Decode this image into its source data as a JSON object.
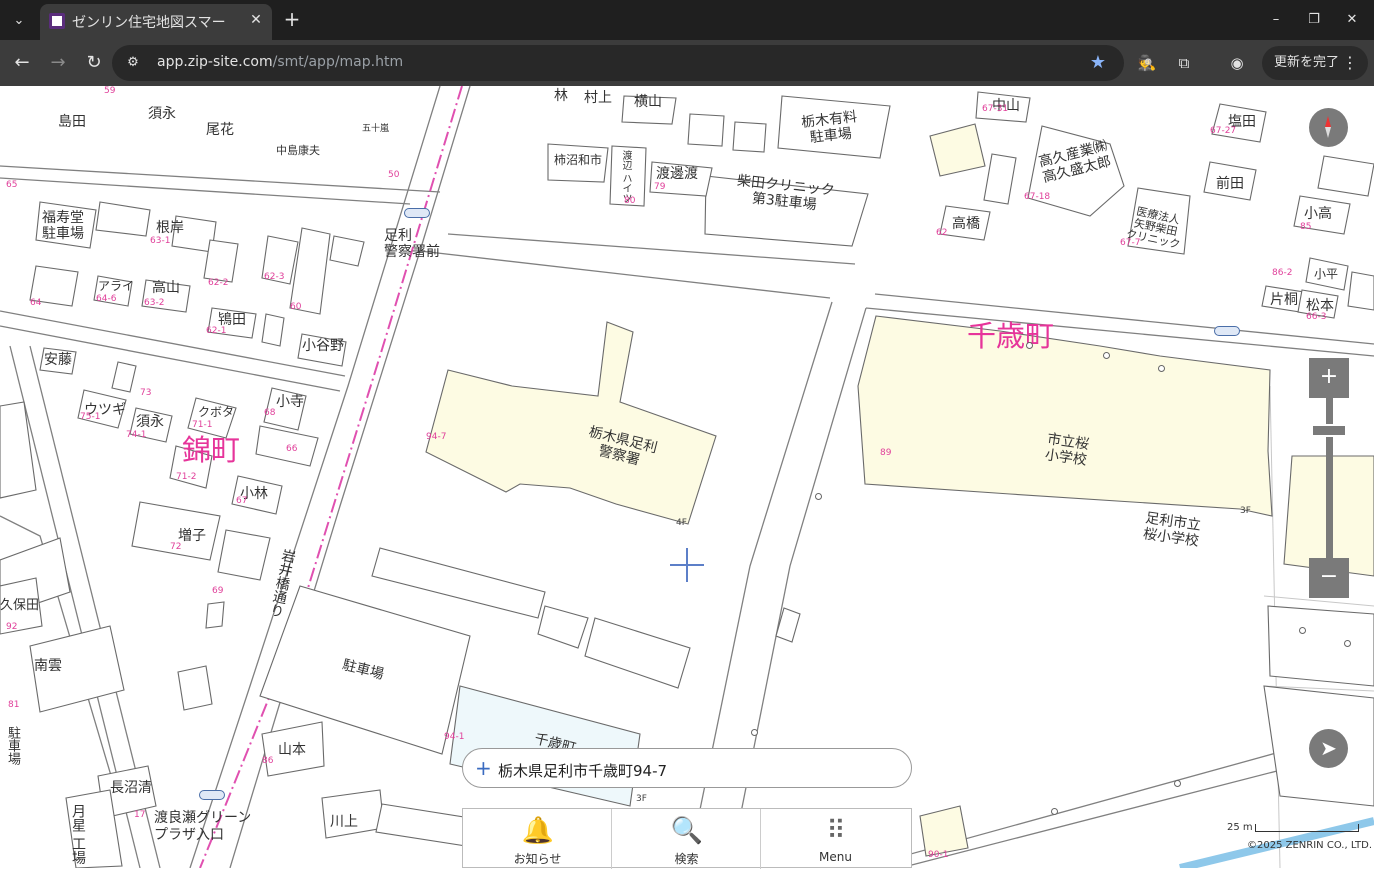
{
  "browser": {
    "tab_title": "ゼンリン住宅地図スマー",
    "url_domain": "app.zip-site.com",
    "url_path": "/smt/app/map.htm",
    "update_label": "更新を完了",
    "accent_color": "#8ab4f8"
  },
  "map": {
    "towns": [
      "千歳町",
      "錦町"
    ],
    "buildings": {
      "police": "栃木県足利\n警察署",
      "school": "市立桜\n小学校",
      "school_name": "足利市立\n桜小学校",
      "parking": "駐車場",
      "paid_parking": "栃木有料\n駐車場",
      "clinic_parking": "柴田クリニック\n第3駐車場",
      "company": "高久産業㈱\n高久盛太郎",
      "hospital": "医療法人\n矢野柴田\nクリニック",
      "fukuju_parking": "福寿堂\n駐車場"
    },
    "stops": {
      "police_stop": "足利\n警察署前",
      "green_plaza": "渡良瀬グリーン\nプラザ入口"
    },
    "street": "岩井橋通り",
    "names": {
      "n1": "島田",
      "n2": "須永",
      "n3": "尾花",
      "n4": "根岸",
      "n5": "高山",
      "n6": "アライ",
      "n7": "鴇田",
      "n8": "小谷野",
      "n9": "安藤",
      "n10": "ウツギ",
      "n11": "須永",
      "n12": "クボタ",
      "n13": "小寺",
      "n14": "小林",
      "n15": "増子",
      "n16": "南雲",
      "n17": "長沼清",
      "n18": "山本",
      "n19": "川上",
      "n20": "柿沼和市",
      "n21": "渡邊渡",
      "n22": "中山",
      "n23": "塩田",
      "n24": "前田",
      "n25": "高橋",
      "n26": "小高",
      "n27": "片桐",
      "n28": "松本",
      "n29": "横山",
      "n30": "林",
      "n31": "中島康夫",
      "n32": "月星\n工場",
      "n33": "久保田",
      "n34": "駐車場",
      "n35": "小平",
      "n36": "渡辺\nハイツ",
      "n37": "千歳町",
      "n38": "五十嵐",
      "n39": "村上"
    },
    "lot_numbers": {
      "p1": "94-7",
      "p2": "89",
      "p3": "4F",
      "p4": "3F",
      "p5": "63-1",
      "p6": "63-2",
      "p7": "64-6",
      "p8": "62-1",
      "p9": "62-2",
      "p10": "62-3",
      "p11": "60",
      "p12": "64",
      "p13": "73",
      "p14": "75-1",
      "p15": "74-1",
      "p16": "71-1",
      "p17": "71-2",
      "p18": "68",
      "p19": "66",
      "p20": "67",
      "p21": "72",
      "p22": "69",
      "p23": "81",
      "p24": "86",
      "p25": "94-1",
      "p26": "92",
      "p27": "62",
      "p28": "67-18",
      "p29": "67-7",
      "p30": "85",
      "p31": "79",
      "p32": "80",
      "p33": "50",
      "p34": "67-31",
      "p35": "67-27",
      "p36": "59",
      "p37": "65",
      "p38": "3F",
      "p39": "90-1",
      "p40": "17",
      "p41": "66-3",
      "p42": "86-2"
    }
  },
  "controls": {
    "zoom_in": "+",
    "zoom_out": "−",
    "zoom_level": 0.82
  },
  "search": {
    "address": "栃木県足利市千歳町94-7"
  },
  "nav": {
    "news": "お知らせ",
    "search": "検索",
    "menu": "Menu"
  },
  "footer": {
    "scale": "25 m",
    "copyright": "©2025 ZENRIN CO., LTD."
  }
}
